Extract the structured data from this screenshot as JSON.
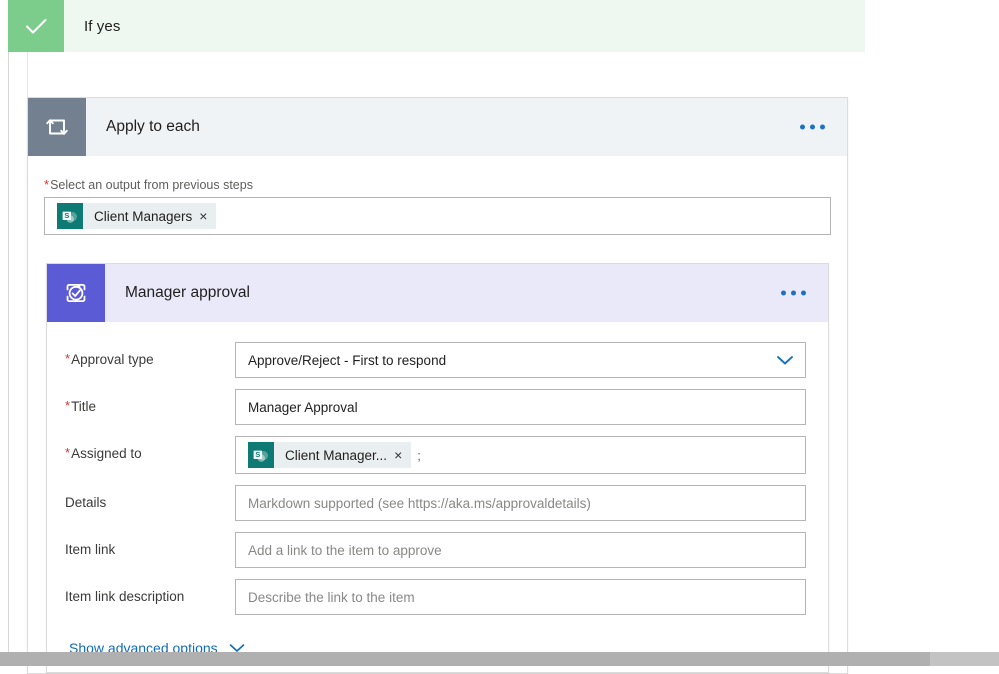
{
  "branch": {
    "label": "If yes",
    "icon": "checkmark-icon",
    "icon_bg": "#7ccc8c",
    "bg": "#eef8f0"
  },
  "apply_to_each": {
    "title": "Apply to each",
    "icon": "loop-repeat-icon",
    "icon_bg": "#73808f",
    "header_bg": "#eff3f6",
    "menu_label": "...",
    "select_output": {
      "label": "Select an output from previous steps",
      "required": true,
      "token": {
        "text": "Client Managers",
        "icon": "sharepoint-icon",
        "icon_bg": "#0d7a74",
        "remove_label": "×"
      }
    }
  },
  "manager_approval": {
    "title": "Manager approval",
    "icon": "approvals-icon",
    "icon_bg": "#5b5bd6",
    "header_bg": "#e9e9f9",
    "menu_label": "...",
    "fields": [
      {
        "label": "Approval type",
        "required": true,
        "type": "dropdown",
        "value": "Approve/Reject - First to respond",
        "chevron": "chevron-down-icon"
      },
      {
        "label": "Title",
        "required": true,
        "type": "text",
        "value": "Manager Approval"
      },
      {
        "label": "Assigned to",
        "required": true,
        "type": "token",
        "token": {
          "text": "Client Manager...",
          "icon": "sharepoint-icon",
          "icon_bg": "#0d7a74",
          "remove_label": "×"
        },
        "separator": ";"
      },
      {
        "label": "Details",
        "required": false,
        "type": "text",
        "placeholder": "Markdown supported (see https://aka.ms/approvaldetails)"
      },
      {
        "label": "Item link",
        "required": false,
        "type": "text",
        "placeholder": "Add a link to the item to approve"
      },
      {
        "label": "Item link description",
        "required": false,
        "type": "text",
        "placeholder": "Describe the link to the item"
      }
    ],
    "advanced": {
      "label": "Show advanced options",
      "chevron": "chevron-down-icon"
    }
  },
  "colors": {
    "accent_blue": "#0f6cbd",
    "required_red": "#d13438",
    "green": "#7ccc8c",
    "purple": "#5b5bd6",
    "teal": "#0d7a74",
    "slate": "#73808f"
  }
}
